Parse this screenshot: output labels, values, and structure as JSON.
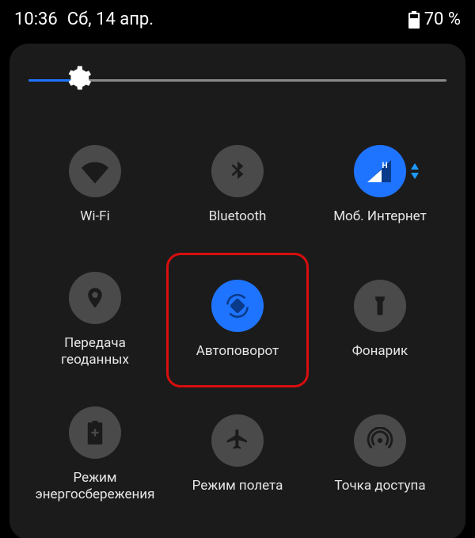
{
  "status": {
    "time": "10:36",
    "date": "Сб, 14 апр.",
    "battery_pct": "70 %"
  },
  "brightness": {
    "value_pct": 12
  },
  "tiles": [
    {
      "id": "wifi",
      "label": "Wi-Fi",
      "state": "off"
    },
    {
      "id": "bluetooth",
      "label": "Bluetooth",
      "state": "off"
    },
    {
      "id": "mobile",
      "label": "Моб. Интернет",
      "state": "on"
    },
    {
      "id": "location",
      "label": "Передача геоданных",
      "state": "off"
    },
    {
      "id": "autorotate",
      "label": "Автоповорот",
      "state": "on",
      "highlight": true
    },
    {
      "id": "flashlight",
      "label": "Фонарик",
      "state": "off"
    },
    {
      "id": "battery",
      "label": "Режим\nэнергосбережения",
      "state": "off"
    },
    {
      "id": "airplane",
      "label": "Режим полета",
      "state": "off"
    },
    {
      "id": "hotspot",
      "label": "Точка доступа",
      "state": "off"
    }
  ],
  "colors": {
    "accent": "#1f74ff",
    "highlight": "#d80e0e",
    "panel": "#1b1b1b",
    "tile_off": "#4a4a4a"
  }
}
